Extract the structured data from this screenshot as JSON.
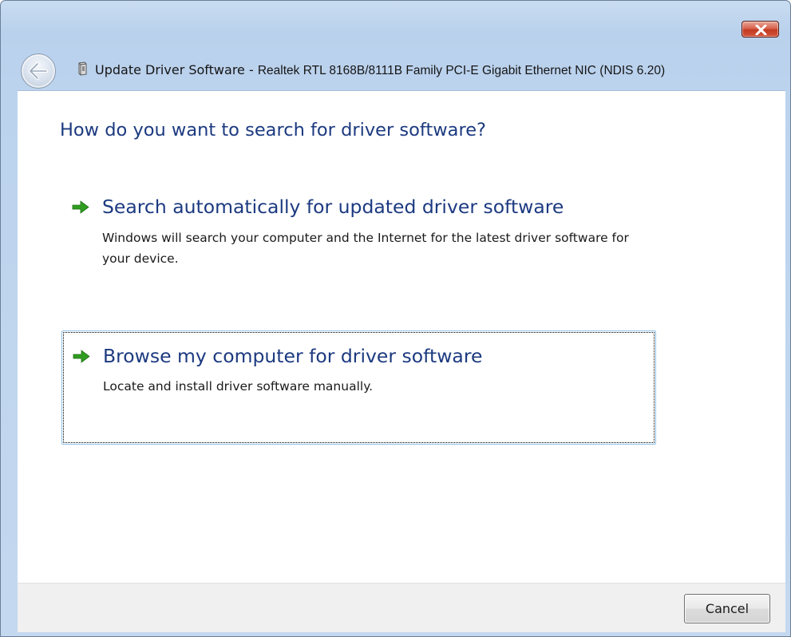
{
  "window": {
    "title_main": "Update Driver Software - ",
    "title_device": "Realtek RTL 8168B/8111B Family PCI-E Gigabit Ethernet NIC (NDIS 6.20)"
  },
  "main": {
    "heading": "How do you want to search for driver software?",
    "options": [
      {
        "title": "Search automatically for updated driver software",
        "description": "Windows will search your computer and the Internet for the latest driver software for your device."
      },
      {
        "title": "Browse my computer for driver software",
        "description": "Locate and install driver software manually."
      }
    ]
  },
  "footer": {
    "cancel_label": "Cancel"
  },
  "icons": {
    "close": "close-icon",
    "back": "back-arrow-icon",
    "device": "device-icon",
    "option_arrow": "green-arrow-icon"
  },
  "colors": {
    "heading": "#1c3a80",
    "arrow": "#2f9d20",
    "close_button": "#c9452c"
  }
}
